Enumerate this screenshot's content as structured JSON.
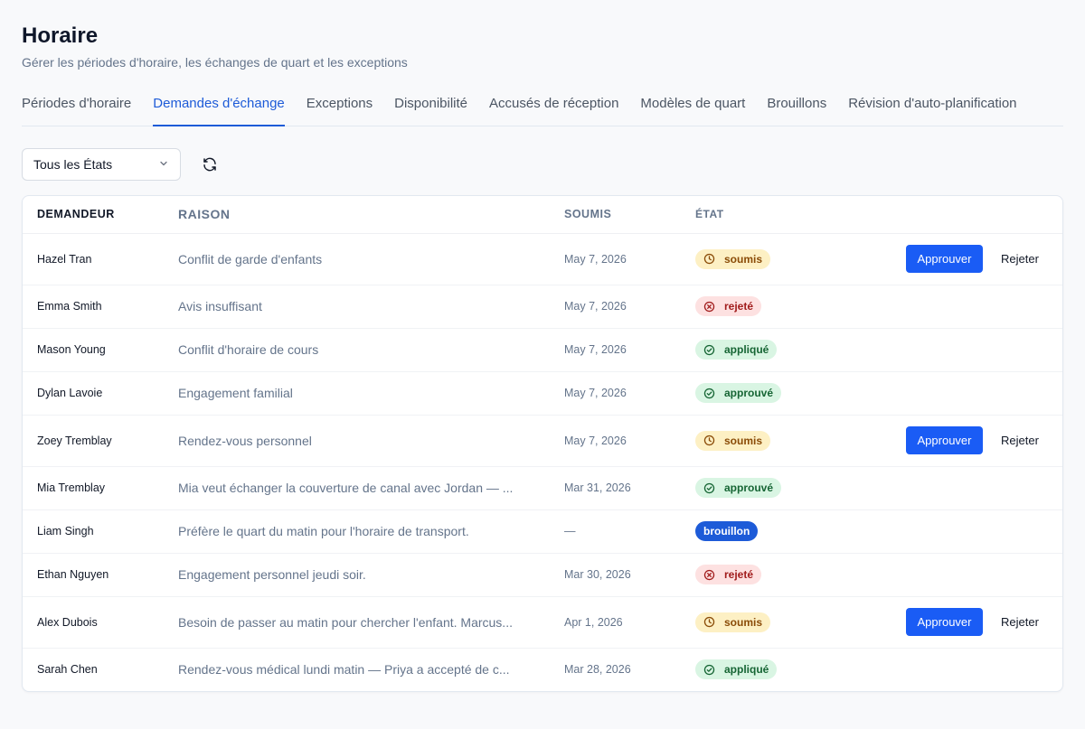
{
  "header": {
    "title": "Horaire",
    "subtitle": "Gérer les périodes d'horaire, les échanges de quart et les exceptions"
  },
  "tabs": [
    {
      "label": "Périodes d'horaire",
      "active": false
    },
    {
      "label": "Demandes d'échange",
      "active": true
    },
    {
      "label": "Exceptions",
      "active": false
    },
    {
      "label": "Disponibilité",
      "active": false
    },
    {
      "label": "Accusés de réception",
      "active": false
    },
    {
      "label": "Modèles de quart",
      "active": false
    },
    {
      "label": "Brouillons",
      "active": false
    },
    {
      "label": "Révision d'auto-planification",
      "active": false
    }
  ],
  "filter": {
    "selected": "Tous les États",
    "icon": "chevron-down-icon"
  },
  "refresh": {
    "icon": "refresh-icon"
  },
  "table": {
    "columns": {
      "requester": "DEMANDEUR",
      "reason": "RAISON",
      "submitted": "SOUMIS",
      "state": "ÉTAT"
    },
    "approve_label": "Approuver",
    "reject_label": "Rejeter",
    "rows": [
      {
        "requester": "Hazel Tran",
        "reason": "Conflit de garde d'enfants",
        "submitted": "May 7, 2026",
        "state": "soumis",
        "status": "soumis",
        "actions": true
      },
      {
        "requester": "Emma Smith",
        "reason": "Avis insuffisant",
        "submitted": "May 7, 2026",
        "state": "rejeté",
        "status": "rejete",
        "actions": false
      },
      {
        "requester": "Mason Young",
        "reason": "Conflit d'horaire de cours",
        "submitted": "May 7, 2026",
        "state": "appliqué",
        "status": "applique",
        "actions": false
      },
      {
        "requester": "Dylan Lavoie",
        "reason": "Engagement familial",
        "submitted": "May 7, 2026",
        "state": "approuvé",
        "status": "approuve",
        "actions": false
      },
      {
        "requester": "Zoey Tremblay",
        "reason": "Rendez-vous personnel",
        "submitted": "May 7, 2026",
        "state": "soumis",
        "status": "soumis",
        "actions": true
      },
      {
        "requester": "Mia Tremblay",
        "reason": "Mia veut échanger la couverture de canal avec Jordan — ...",
        "submitted": "Mar 31, 2026",
        "state": "approuvé",
        "status": "approuve",
        "actions": false
      },
      {
        "requester": "Liam Singh",
        "reason": "Préfère le quart du matin pour l'horaire de transport.",
        "submitted": "—",
        "state": "brouillon",
        "status": "brouillon",
        "actions": false
      },
      {
        "requester": "Ethan Nguyen",
        "reason": "Engagement personnel jeudi soir.",
        "submitted": "Mar 30, 2026",
        "state": "rejeté",
        "status": "rejete",
        "actions": false
      },
      {
        "requester": "Alex Dubois",
        "reason": "Besoin de passer au matin pour chercher l'enfant. Marcus...",
        "submitted": "Apr 1, 2026",
        "state": "soumis",
        "status": "soumis",
        "actions": true
      },
      {
        "requester": "Sarah Chen",
        "reason": "Rendez-vous médical lundi matin — Priya a accepté de c...",
        "submitted": "Mar 28, 2026",
        "state": "appliqué",
        "status": "applique",
        "actions": false
      }
    ]
  },
  "colors": {
    "accent": "#1d5bd8",
    "button": "#1a5cf5",
    "pending_bg": "#fdf0c4",
    "rejected_bg": "#fde1e1",
    "success_bg": "#d9f5e3"
  }
}
